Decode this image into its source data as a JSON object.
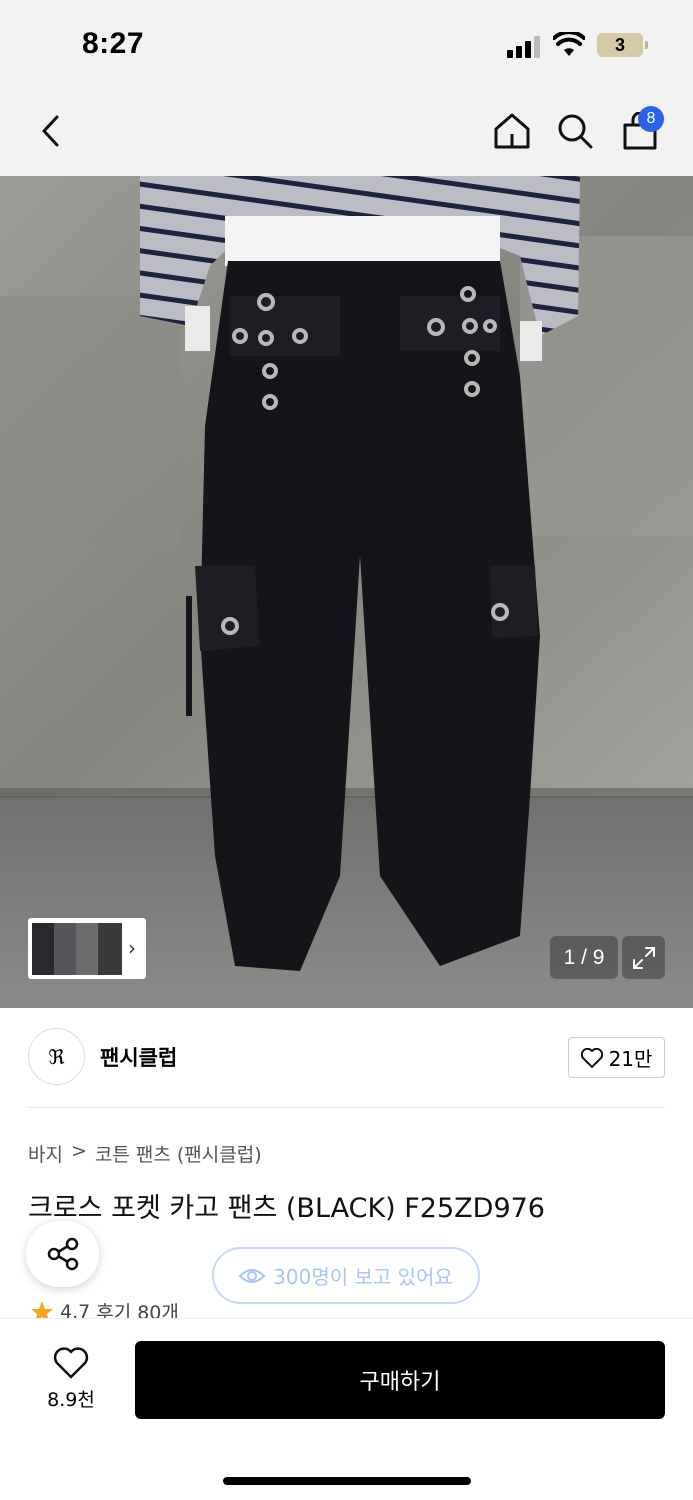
{
  "status_bar": {
    "time": "8:27",
    "battery": "3"
  },
  "nav": {
    "cart_count": "8"
  },
  "gallery": {
    "counter": "1 / 9"
  },
  "brand": {
    "logo_text": "ℜ",
    "name": "팬시클럽",
    "likes": "21만"
  },
  "breadcrumb": {
    "category": "바지",
    "separator": ">",
    "subcategory": "코튼 팬츠 (팬시클럽)"
  },
  "product": {
    "title": "크로스 포켓 카고 팬츠 (BLACK) F25ZD976"
  },
  "viewers": {
    "text": "300명이 보고 있어요"
  },
  "rating": {
    "score": "4.7",
    "reviews": "후기 80개"
  },
  "bottom": {
    "wish_count": "8.9천",
    "buy_label": "구매하기"
  },
  "colors": {
    "badge": "#2a62e8",
    "star": "#f5a623",
    "viewer_text": "#a8c4ff"
  }
}
